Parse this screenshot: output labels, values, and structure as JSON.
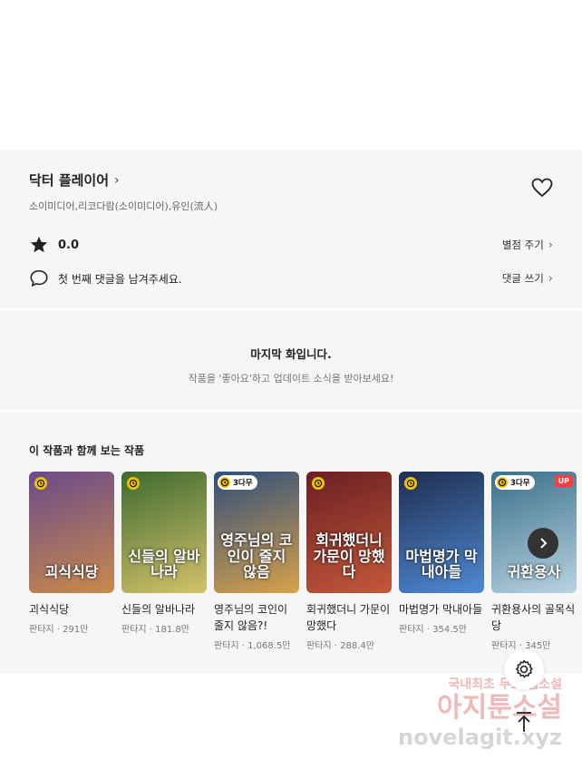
{
  "work": {
    "title": "닥터 플레이어",
    "authors": "소이미디어,리코다람(소이미디어),유인(流人)",
    "rating": "0.0",
    "rate_link": "별점 주기",
    "comment_prompt": "첫 번째 댓글을 남겨주세요.",
    "comment_link": "댓글 쓰기"
  },
  "last_episode": {
    "title": "마지막 화입니다.",
    "subtitle": "작품을 '좋아요'하고 업데이트 소식을 받아보세요!"
  },
  "recommendations": {
    "heading": "이 작품과 함께 보는 작품",
    "items": [
      {
        "title": "괴식식당",
        "meta": "판타지 · 291만",
        "badge": "",
        "up": "",
        "cover_text": "괴식식당",
        "color1": "#6b4a8a",
        "color2": "#c98a4a"
      },
      {
        "title": "신들의 알바나라",
        "meta": "판타지 · 181.8만",
        "badge": "",
        "up": "",
        "cover_text": "신들의 알바나라",
        "color1": "#3e6a2f",
        "color2": "#d3c26b"
      },
      {
        "title": "영주님의 코인이 줄지 않음?!",
        "meta": "판타지 · 1,068.5만",
        "badge": "3다무",
        "up": "",
        "cover_text": "영주님의 코인이 줄지 않음",
        "color1": "#2f4f7a",
        "color2": "#d9a14b"
      },
      {
        "title": "회귀했더니 가문이 망했다",
        "meta": "판타지 · 288.4만",
        "badge": "",
        "up": "",
        "cover_text": "회귀했더니 가문이 망했다",
        "color1": "#6a1f22",
        "color2": "#c4583a"
      },
      {
        "title": "마법명가 막내아들",
        "meta": "판타지 · 354.5만",
        "badge": "",
        "up": "",
        "cover_text": "마법명가 막내아들",
        "color1": "#1f2d4f",
        "color2": "#4f8ad4"
      },
      {
        "title": "귀환용사의 골목식당",
        "meta": "판타지 · 345만",
        "badge": "3다무",
        "up": "UP",
        "cover_text": "귀환용사",
        "color1": "#3a6f8a",
        "color2": "#b9d3e2"
      }
    ]
  },
  "watermark": {
    "line1": "국내최초 무료 웹소설",
    "line2": "아지툰소설",
    "line3": "novelagit.xyz"
  },
  "icons": [
    "heart-icon",
    "star-icon",
    "comment-icon",
    "chevron-right-icon",
    "clock-icon",
    "gear-icon",
    "arrow-up-icon"
  ],
  "colors": {
    "badge_yellow": "#f2c300",
    "up_red": "#ff3b3b",
    "panel_bg": "#f6f6f6"
  }
}
